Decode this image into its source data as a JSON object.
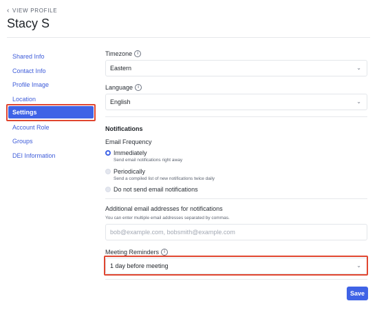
{
  "header": {
    "back_label": "VIEW PROFILE",
    "title": "Stacy S"
  },
  "sidebar": {
    "items": [
      {
        "label": "Shared Info"
      },
      {
        "label": "Contact Info"
      },
      {
        "label": "Profile Image"
      },
      {
        "label": "Location"
      },
      {
        "label": "Settings"
      },
      {
        "label": "Account Role"
      },
      {
        "label": "Groups"
      },
      {
        "label": "DEI Information"
      }
    ],
    "active_index": 4
  },
  "settings": {
    "timezone": {
      "label": "Timezone",
      "value": "Eastern"
    },
    "language": {
      "label": "Language",
      "value": "English"
    },
    "notifications": {
      "title": "Notifications",
      "email_frequency_label": "Email Frequency",
      "options": [
        {
          "label": "Immediately",
          "description": "Send email notifications right away",
          "checked": true
        },
        {
          "label": "Periodically",
          "description": "Send a compiled list of new notifications twice daily",
          "checked": false
        },
        {
          "label": "Do not send email notifications",
          "description": "",
          "checked": false
        }
      ]
    },
    "additional_emails": {
      "label": "Additional email addresses for notifications",
      "help": "You can enter multiple email addresses separated by commas.",
      "placeholder": "bob@example.com, bobsmith@example.com"
    },
    "meeting_reminders": {
      "label": "Meeting Reminders",
      "value": "1 day before meeting"
    }
  },
  "actions": {
    "save_label": "Save"
  },
  "colors": {
    "accent": "#3f63e6",
    "highlight": "#e0452f"
  }
}
